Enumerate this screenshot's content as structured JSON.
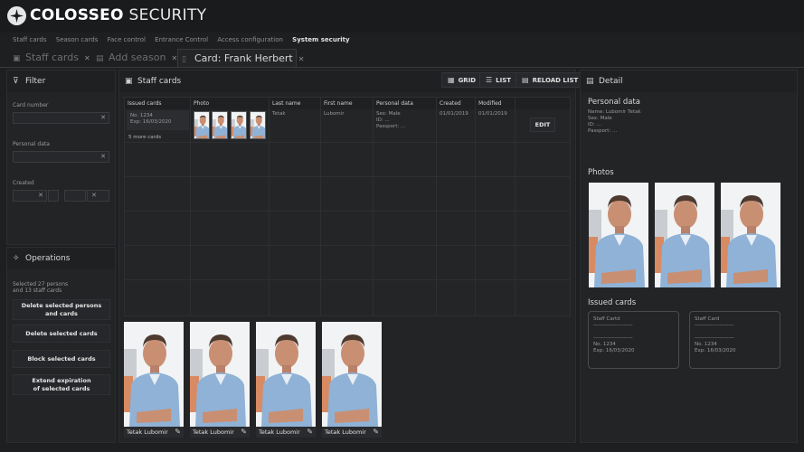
{
  "app": {
    "brand_bold": "COLOSSEO",
    "brand_rest": "SECURITY"
  },
  "topnav": [
    "Staff cards",
    "Season cards",
    "Face control",
    "Entrance Control",
    "Access configuration",
    "System security"
  ],
  "tabs": [
    {
      "label": "Staff cards",
      "icon": "id-card-icon"
    },
    {
      "label": "Add season",
      "icon": "add-card-icon"
    },
    {
      "label": "Card: Frank Herbert",
      "icon": "card-icon"
    }
  ],
  "filter": {
    "title": "Filter",
    "card_number_label": "Card number",
    "personal_data_label": "Personal data",
    "created_label": "Created"
  },
  "operations": {
    "title": "Operations",
    "selected_text_1": "Selected 27 persons",
    "selected_text_2": "and 13 staff cards",
    "buttons": [
      {
        "line1": "Delete selected persons",
        "line2": "and cards"
      },
      {
        "line1": "Delete selected cards",
        "line2": ""
      },
      {
        "line1": "Block selected cards",
        "line2": ""
      },
      {
        "line1": "Extend expiration",
        "line2": "of selected cards"
      }
    ]
  },
  "staff": {
    "title": "Staff cards",
    "grid_btn": "GRID",
    "list_btn": "LIST",
    "reload_btn": "RELOAD LIST",
    "columns": [
      "Issued cards",
      "Photo",
      "Last name",
      "First name",
      "Personal data",
      "Created",
      "Modified"
    ],
    "row": {
      "card_no": "No. 1234",
      "card_exp": "Exp: 16/03/2020",
      "more": "5 more cards",
      "last_name": "Tetak",
      "first_name": "Lubomir",
      "sex": "Sex: Male",
      "id": "ID: ...",
      "passport": "Passport: ...",
      "created": "01/01/2019",
      "modified": "01/01/2019",
      "edit": "EDIT"
    },
    "cards": [
      "Tetak Lubomir",
      "Tetak Lubomir",
      "Tetak Lubomir",
      "Tetak Lubomir"
    ]
  },
  "detail": {
    "title": "Detail",
    "personal_title": "Personal data",
    "name": "Name: Lubomir Tetak",
    "sex": "Sex: Male",
    "id": "ID: ...",
    "passport": "Passport: ...",
    "photos_title": "Photos",
    "issued_title": "Issued cards",
    "issued": [
      {
        "title": "Staff Cartd",
        "dash1": "----------------------",
        "dash2": "----------------------",
        "no": "No. 1234",
        "exp": "Exp: 16/03/2020"
      },
      {
        "title": "Staff Card",
        "dash1": "----------------------",
        "dash2": "----------------------",
        "no": "No. 1234",
        "exp": "Exp: 16/03/2020"
      }
    ]
  },
  "colors": {
    "background": "#1e1f21",
    "panel": "#232426",
    "accent_text": "#e6e6e6"
  }
}
